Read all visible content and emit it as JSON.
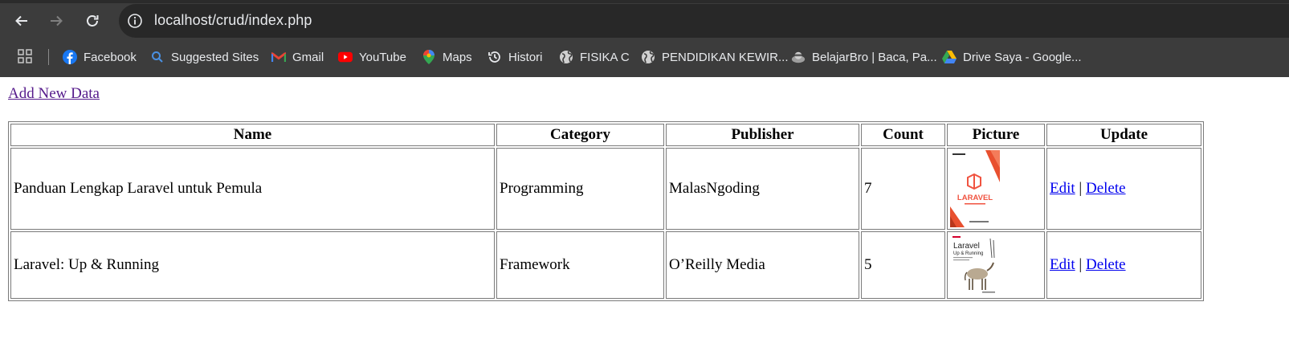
{
  "browser": {
    "url": "localhost/crud/index.php",
    "bookmarks": [
      {
        "label": "Facebook",
        "icon": "facebook-icon"
      },
      {
        "label": "Suggested Sites",
        "icon": "search-icon"
      },
      {
        "label": "Gmail",
        "icon": "gmail-icon"
      },
      {
        "label": "YouTube",
        "icon": "youtube-icon"
      },
      {
        "label": "Maps",
        "icon": "maps-pin-icon"
      },
      {
        "label": "Histori",
        "icon": "history-icon"
      },
      {
        "label": "FISIKA C",
        "icon": "globe-icon"
      },
      {
        "label": "PENDIDIKAN KEWIR...",
        "icon": "globe-icon"
      },
      {
        "label": "BelajarBro | Baca, Pa...",
        "icon": "belajarbro-icon"
      },
      {
        "label": "Drive Saya - Google...",
        "icon": "drive-icon"
      }
    ]
  },
  "page": {
    "add_link": "Add New Data",
    "headers": [
      "Name",
      "Category",
      "Publisher",
      "Count",
      "Picture",
      "Update"
    ],
    "rows": [
      {
        "name": "Panduan Lengkap Laravel untuk Pemula",
        "category": "Programming",
        "publisher": "MalasNgoding",
        "count": "7",
        "edit": "Edit",
        "sep": "|",
        "delete": "Delete"
      },
      {
        "name": "Laravel: Up & Running",
        "category": "Framework",
        "publisher": "O’Reilly Media",
        "count": "5",
        "edit": "Edit",
        "sep": "|",
        "delete": "Delete"
      }
    ],
    "covers": [
      {
        "title": "LARAVEL"
      },
      {
        "title": "Laravel",
        "subtitle": "Up & Running"
      }
    ]
  },
  "colors": {
    "chrome": "#3c3c3c",
    "omnibox": "#282828",
    "visited_link": "#551a8b",
    "link": "#0000ee",
    "laravel_red": "#f05340"
  }
}
